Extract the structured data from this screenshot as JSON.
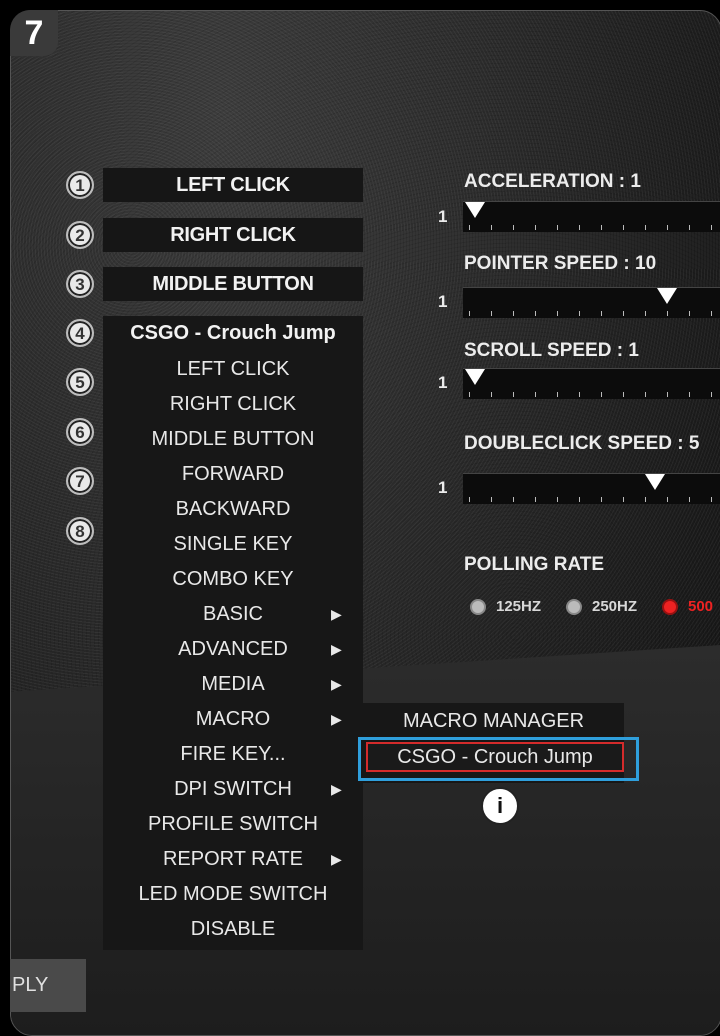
{
  "step_number": "7",
  "buttons": [
    {
      "num": "1",
      "label": "LEFT CLICK"
    },
    {
      "num": "2",
      "label": "RIGHT CLICK"
    },
    {
      "num": "3",
      "label": "MIDDLE BUTTON"
    },
    {
      "num": "4",
      "label": "CSGO - Crouch Jump"
    },
    {
      "num": "5"
    },
    {
      "num": "6"
    },
    {
      "num": "7"
    },
    {
      "num": "8"
    }
  ],
  "menu": {
    "items": [
      {
        "label": "LEFT CLICK"
      },
      {
        "label": "RIGHT CLICK"
      },
      {
        "label": "MIDDLE BUTTON"
      },
      {
        "label": "FORWARD"
      },
      {
        "label": "BACKWARD"
      },
      {
        "label": "SINGLE KEY"
      },
      {
        "label": "COMBO KEY"
      },
      {
        "label": "BASIC",
        "submenu": true
      },
      {
        "label": "ADVANCED",
        "submenu": true
      },
      {
        "label": "MEDIA",
        "submenu": true
      },
      {
        "label": "MACRO",
        "submenu": true
      },
      {
        "label": "FIRE KEY..."
      },
      {
        "label": "DPI SWITCH",
        "submenu": true
      },
      {
        "label": "PROFILE SWITCH"
      },
      {
        "label": "REPORT RATE",
        "submenu": true
      },
      {
        "label": "LED MODE SWITCH"
      },
      {
        "label": "DISABLE"
      }
    ],
    "arrow_glyph": "▶"
  },
  "submenu": {
    "manager": "MACRO MANAGER",
    "selected": "CSGO - Crouch Jump"
  },
  "info_marker": "i",
  "settings": {
    "acceleration": {
      "label": "ACCELERATION : 1",
      "min": "1"
    },
    "pointer_speed": {
      "label": "POINTER SPEED : 10",
      "min": "1"
    },
    "scroll_speed": {
      "label": "SCROLL SPEED : 1",
      "min": "1"
    },
    "doubleclick_speed": {
      "label": "DOUBLECLICK SPEED : 5",
      "min": "1"
    }
  },
  "polling": {
    "label": "POLLING RATE",
    "options": [
      "125HZ",
      "250HZ",
      "500"
    ],
    "selected": "500"
  },
  "apply_label": "PLY",
  "colors": {
    "highlight_border": "#2f9fdc",
    "selected_outline": "#d42b2b",
    "radio_active": "#e22222"
  }
}
